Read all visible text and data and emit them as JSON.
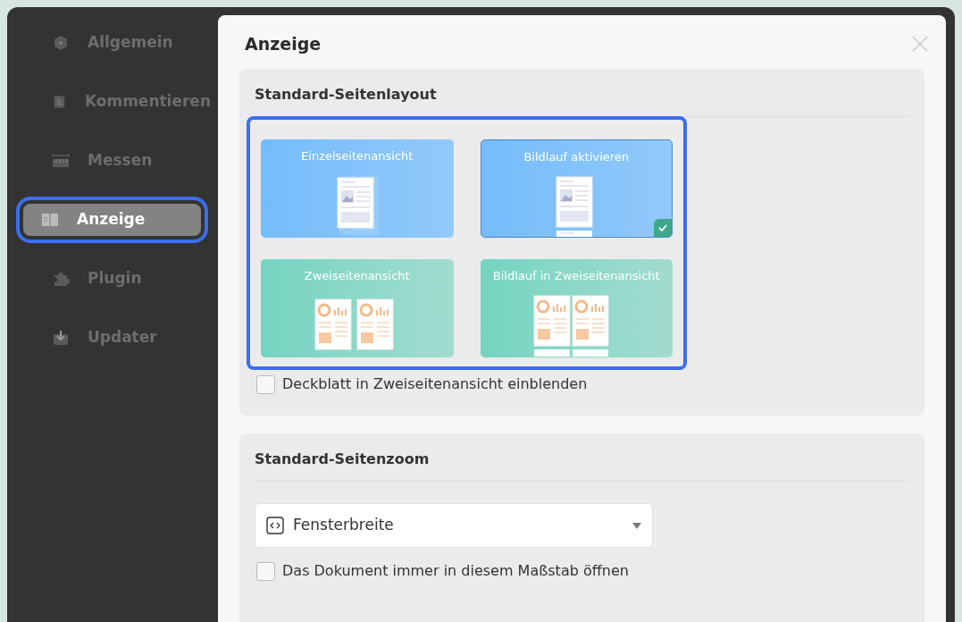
{
  "sidebar": {
    "items": [
      {
        "label": "Allgemein",
        "kind": "general",
        "selected": false
      },
      {
        "label": "Kommentieren",
        "kind": "comment",
        "selected": false
      },
      {
        "label": "Messen",
        "kind": "measure",
        "selected": false
      },
      {
        "label": "Anzeige",
        "kind": "display",
        "selected": true
      },
      {
        "label": "Plugin",
        "kind": "plugin",
        "selected": false
      },
      {
        "label": "Updater",
        "kind": "update",
        "selected": false
      }
    ]
  },
  "dialog": {
    "title": "Anzeige",
    "layout_section": {
      "title": "Standard-Seitenlayout",
      "options": [
        {
          "label": "Einzelseitenansicht",
          "kind": "single",
          "selected": false
        },
        {
          "label": "Bildlauf aktivieren",
          "kind": "scroll",
          "selected": true
        },
        {
          "label": "Zweiseitenansicht",
          "kind": "double",
          "selected": false
        },
        {
          "label": "Bildlauf in Zweiseitenansicht",
          "kind": "scroll-double",
          "selected": false
        }
      ],
      "checkbox": {
        "label": "Deckblatt in Zweiseitenansicht einblenden",
        "checked": false
      }
    },
    "zoom_section": {
      "title": "Standard-Seitenzoom",
      "dropdown": {
        "value": "Fensterbreite"
      },
      "checkbox": {
        "label": "Das Dokument immer in diesem Maßstab öffnen",
        "checked": false
      }
    }
  }
}
